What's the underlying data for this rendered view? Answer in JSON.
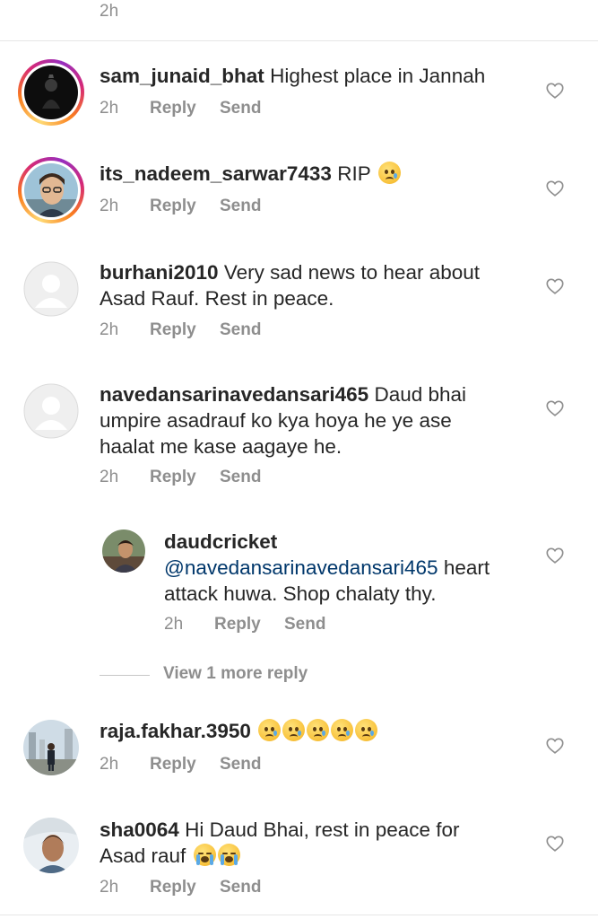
{
  "top": {
    "time": "2h"
  },
  "actions": {
    "reply": "Reply",
    "send": "Send"
  },
  "comments": [
    {
      "username": "sam_junaid_bhat",
      "text": "Highest place in Jannah",
      "time": "2h",
      "avatar": "dark-figure-avatar",
      "story_ring": true
    },
    {
      "username": "its_nadeem_sarwar7433",
      "text": "RIP",
      "emoji": [
        "crying-face"
      ],
      "time": "2h",
      "avatar": "selfie-avatar",
      "story_ring": true
    },
    {
      "username": "burhani2010",
      "text": "Very sad news to hear about",
      "text2": "Asad Rauf. Rest in peace.",
      "time": "2h",
      "avatar": "default-avatar"
    },
    {
      "username": "navedansarinavedansari465",
      "text": "Daud bhai",
      "text2": "umpire asadrauf ko kya hoya he ye ase",
      "text3": "haalat me kase aagaye he.",
      "time": "2h",
      "avatar": "default-avatar"
    },
    {
      "username": "daudcricket",
      "mention": "@navedansarinavedansari465",
      "text": "heart",
      "text2": "attack huwa. Shop chalaty thy.",
      "time": "2h",
      "avatar": "portrait-avatar",
      "reply": true
    },
    {
      "username": "raja.fakhar.3950",
      "emoji": [
        "crying-face",
        "crying-face",
        "crying-face",
        "crying-face",
        "crying-face"
      ],
      "time": "2h",
      "avatar": "outdoor-avatar"
    },
    {
      "username": "sha0064",
      "text": "Hi Daud Bhai, rest in peace for",
      "text2": "Asad rauf",
      "emoji": [
        "loudly-crying-face",
        "loudly-crying-face"
      ],
      "time": "2h",
      "avatar": "young-man-avatar"
    }
  ],
  "view_more": {
    "label": "View 1 more reply"
  },
  "icons": {
    "like": "heart-outline-icon"
  },
  "colors": {
    "text": "#262626",
    "meta": "#8e8e8e",
    "mention": "#00376b",
    "divider": "#e6e6e6"
  }
}
